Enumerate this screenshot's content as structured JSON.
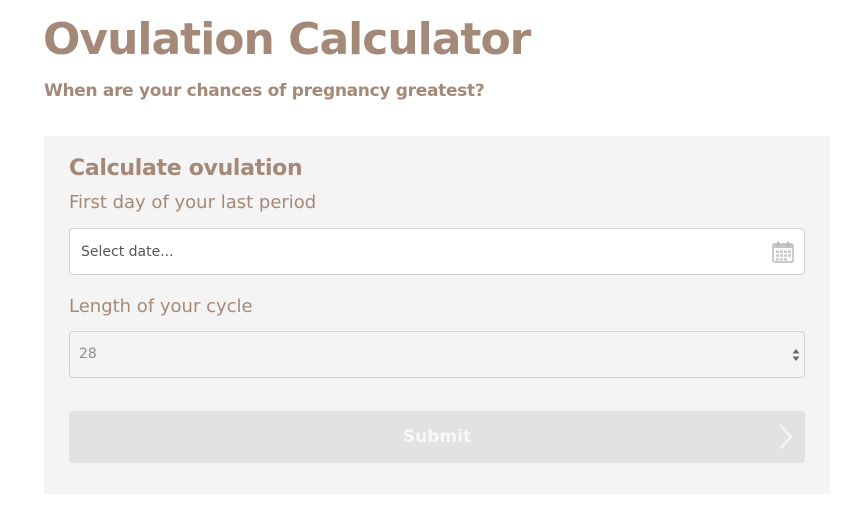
{
  "header": {
    "title": "Ovulation Calculator",
    "subtitle": "When are your chances of pregnancy greatest?"
  },
  "form": {
    "heading": "Calculate ovulation",
    "date_field": {
      "label": "First day of your last period",
      "placeholder": "Select date...",
      "value": "",
      "icon": "calendar-icon"
    },
    "cycle_field": {
      "label": "Length of your cycle",
      "selected": "28",
      "icon": "select-arrows-icon"
    },
    "submit": {
      "label": "Submit",
      "icon": "arrow-right-icon",
      "state": "disabled"
    }
  },
  "colors": {
    "brand_text": "#a48979",
    "card_background": "#f4f4f4",
    "input_border": "#d2d2d2",
    "button_disabled": "#e2e2e2",
    "button_text": "#f8f8f8"
  }
}
